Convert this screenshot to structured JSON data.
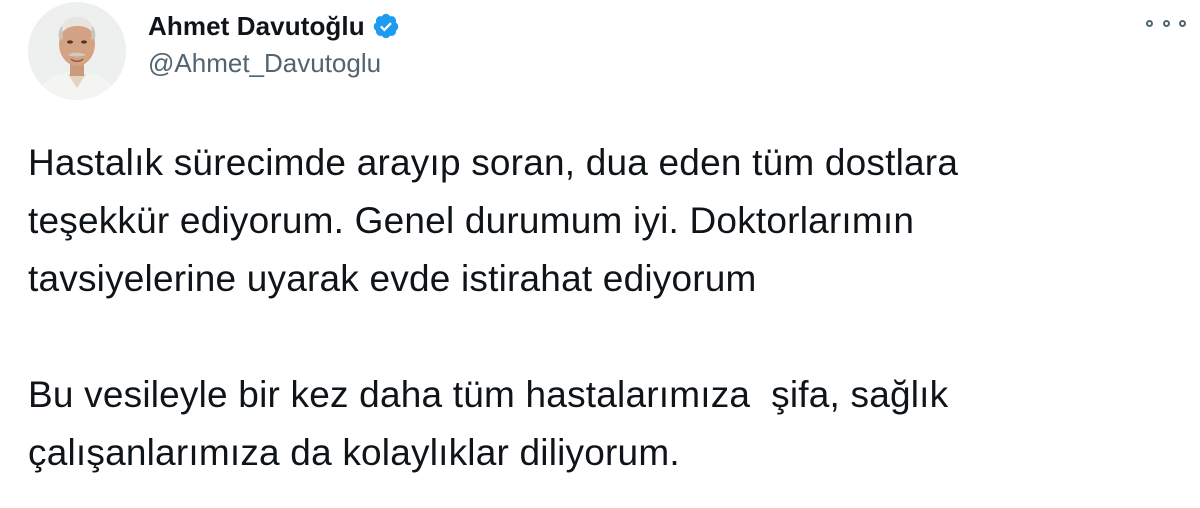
{
  "tweet": {
    "author": {
      "display_name": "Ahmet Davutoğlu",
      "handle": "@Ahmet_Davutoglu",
      "verified": true
    },
    "more_icon": "more-options-icon",
    "verified_icon": "verified-badge-icon",
    "paragraphs": [
      {
        "lines": [
          "Hastalık sürecimde arayıp soran, dua eden tüm dostlara",
          "teşekkür ediyorum. Genel durumum iyi. Doktorlarımın",
          "tavsiyelerine uyarak evde istirahat ediyorum"
        ]
      },
      {
        "lines": [
          "Bu vesileyle bir kez daha tüm hastalarımıza  şifa, sağlık",
          "çalışanlarımıza da kolaylıklar diliyorum."
        ]
      }
    ],
    "colors": {
      "text": "#0f1419",
      "secondary": "#536471",
      "verified": "#1d9bf0"
    }
  }
}
